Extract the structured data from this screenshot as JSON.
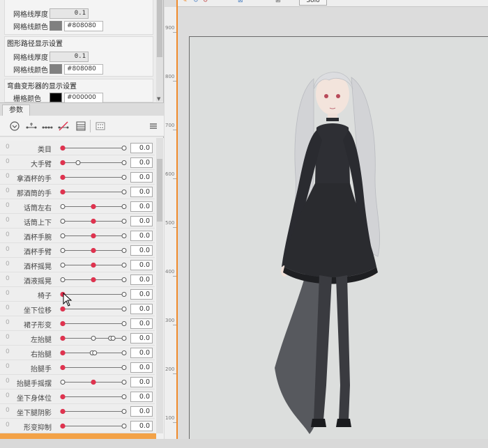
{
  "grid_settings": {
    "thickness_label": "网格线厚度",
    "thickness_value": "0.1",
    "color_label": "网格线颜色",
    "color_value": "#808080"
  },
  "path_settings": {
    "title": "图形路径显示设置",
    "thickness_label": "网格线厚度",
    "thickness_value": "0.1",
    "color_label": "网格线颜色",
    "color_value": "#808080"
  },
  "deformer_settings": {
    "title": "弯曲变形器的显示设置",
    "color_label": "栅格颜色",
    "color_value": "#000000"
  },
  "params_panel": {
    "tab_label": "参数",
    "icons": [
      "expand-icon",
      "link-key-icon",
      "multi-key-icon",
      "delete-key-icon",
      "table-icon",
      "grid-icon",
      "menu-icon"
    ]
  },
  "parameters": [
    {
      "name": "类目",
      "value": "0.0",
      "knob": 0.0,
      "keys": [
        0,
        1
      ],
      "accent": true
    },
    {
      "name": "大手臂",
      "value": "0.0",
      "knob": 0.0,
      "keys": [
        0,
        0.25,
        1
      ],
      "accent": true
    },
    {
      "name": "拿酒杯的手",
      "value": "0.0",
      "knob": 0.0,
      "keys": [
        0,
        1
      ],
      "accent": true
    },
    {
      "name": "那酒筒的手",
      "value": "0.0",
      "knob": 0.0,
      "keys": [
        0,
        1
      ],
      "accent": true
    },
    {
      "name": "话筒左右",
      "value": "0.0",
      "knob": 0.5,
      "keys": [
        0,
        0.5,
        1
      ],
      "accent": true
    },
    {
      "name": "话筒上下",
      "value": "0.0",
      "knob": 0.5,
      "keys": [
        0,
        0.5,
        1
      ],
      "accent": true
    },
    {
      "name": "酒杯手腕",
      "value": "0.0",
      "knob": 0.5,
      "keys": [
        0,
        0.5,
        1
      ],
      "accent": true
    },
    {
      "name": "酒杯手臂",
      "value": "0.0",
      "knob": 0.5,
      "keys": [
        0,
        0.5,
        1
      ],
      "accent": true
    },
    {
      "name": "酒杯摇晃",
      "value": "0.0",
      "knob": 0.5,
      "keys": [
        0,
        0.5,
        1
      ],
      "accent": true
    },
    {
      "name": "酒液摇晃",
      "value": "0.0",
      "knob": 0.5,
      "keys": [
        0,
        0.5,
        1
      ],
      "accent": true
    },
    {
      "name": "椅子",
      "value": "0.0",
      "knob": 0.0,
      "keys": [
        0,
        1
      ],
      "accent": true
    },
    {
      "name": "坐下位移",
      "value": "0.0",
      "knob": 0.0,
      "keys": [
        0,
        1
      ],
      "accent": true
    },
    {
      "name": "裙子形变",
      "value": "0.0",
      "knob": 0.0,
      "keys": [
        0,
        1
      ],
      "accent": true
    },
    {
      "name": "左抬腿",
      "value": "0.0",
      "knob": 0.0,
      "keys": [
        0,
        0.5,
        0.78,
        0.82,
        1
      ],
      "accent": true
    },
    {
      "name": "右抬腿",
      "value": "0.0",
      "knob": 0.0,
      "keys": [
        0,
        0.48,
        0.52,
        1
      ],
      "accent": true
    },
    {
      "name": "抬腿手",
      "value": "0.0",
      "knob": 0.0,
      "keys": [
        0,
        1
      ],
      "accent": true
    },
    {
      "name": "抬腿手摇摆",
      "value": "0.0",
      "knob": 0.5,
      "keys": [
        0,
        0.5,
        1
      ],
      "accent": true
    },
    {
      "name": "坐下身体位移",
      "value": "0.0",
      "knob": 0.0,
      "keys": [
        0,
        1
      ],
      "accent": true
    },
    {
      "name": "坐下腿阴影",
      "value": "0.0",
      "knob": 0.0,
      "keys": [
        0,
        1
      ],
      "accent": true
    },
    {
      "name": "形变抑制",
      "value": "0.0",
      "knob": 0.0,
      "keys": [
        0,
        1
      ],
      "accent": true
    }
  ],
  "ruler": {
    "labels": [
      "900",
      "800",
      "700",
      "600",
      "500",
      "400",
      "300",
      "200",
      "100"
    ]
  },
  "toolbar": {
    "solo_label": "Solo"
  },
  "colors": {
    "accent": "#e0334f",
    "highlight": "#f08a2a"
  }
}
